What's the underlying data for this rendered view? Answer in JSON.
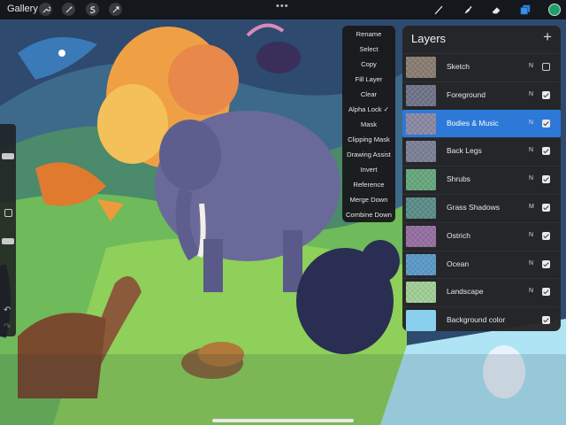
{
  "topbar": {
    "gallery_label": "Gallery",
    "left_tools": [
      "wrench-icon",
      "magic-wand-icon",
      "selection-s-icon",
      "arrow-transform-icon"
    ],
    "right_tools": [
      "brush-icon",
      "smudge-icon",
      "eraser-icon",
      "layers-icon"
    ],
    "active_color": "#1aa06a"
  },
  "context_menu": {
    "items": [
      "Rename",
      "Select",
      "Copy",
      "Fill Layer",
      "Clear",
      "Alpha Lock ✓",
      "Mask",
      "Clipping Mask",
      "Drawing Assist",
      "Invert",
      "Reference",
      "Merge Down",
      "Combine Down"
    ]
  },
  "layers_panel": {
    "title": "Layers",
    "add_label": "+",
    "rows": [
      {
        "name": "Sketch",
        "blend": "N",
        "visible": false,
        "selected": false,
        "thumb": "#6b5a4a"
      },
      {
        "name": "Foreground",
        "blend": "N",
        "visible": true,
        "selected": false,
        "thumb": "#4a4f6a"
      },
      {
        "name": "Bodies & Music",
        "blend": "N",
        "visible": true,
        "selected": true,
        "thumb": "#6c6a8a"
      },
      {
        "name": "Back Legs",
        "blend": "N",
        "visible": true,
        "selected": false,
        "thumb": "#5a5f7a"
      },
      {
        "name": "Shrubs",
        "blend": "N",
        "visible": true,
        "selected": false,
        "thumb": "#3f8f5a"
      },
      {
        "name": "Grass Shadows",
        "blend": "M",
        "visible": true,
        "selected": false,
        "thumb": "#2f6e6a"
      },
      {
        "name": "Ostrich",
        "blend": "N",
        "visible": true,
        "selected": false,
        "thumb": "#7a4a8a"
      },
      {
        "name": "Ocean",
        "blend": "N",
        "visible": true,
        "selected": false,
        "thumb": "#2f7fb8"
      },
      {
        "name": "Landscape",
        "blend": "N",
        "visible": true,
        "selected": false,
        "thumb": "#8ac27a"
      },
      {
        "name": "Background color",
        "blend": "",
        "visible": true,
        "selected": false,
        "thumb": "#8ad0ee"
      }
    ]
  },
  "sidebar": {
    "undo_glyph": "↶",
    "redo_glyph": "↷",
    "brush_size": 0.22,
    "opacity": 0.85
  }
}
